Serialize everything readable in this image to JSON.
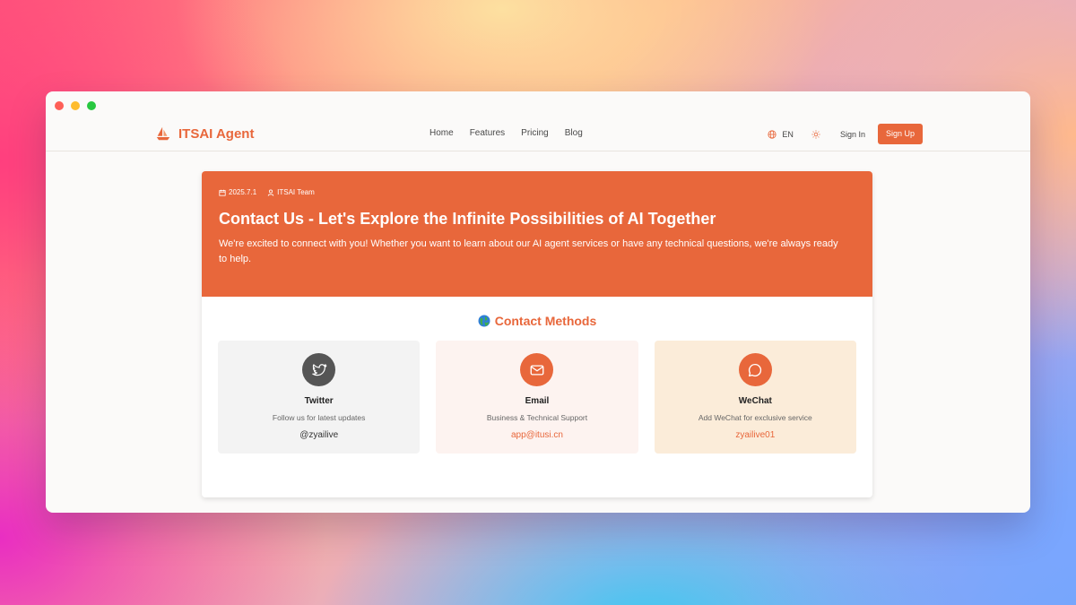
{
  "colors": {
    "accent": "#e8673b",
    "twitter_icon_bg": "#555555"
  },
  "brand": {
    "name": "ITSAI Agent",
    "logo_icon": "sailboat-icon"
  },
  "nav": {
    "links": [
      "Home",
      "Features",
      "Pricing",
      "Blog"
    ],
    "language": "EN",
    "sign_in": "Sign In",
    "sign_up": "Sign Up"
  },
  "hero": {
    "date": "2025.7.1",
    "author": "ITSAI Team",
    "title": "Contact Us - Let's Explore the Infinite Possibilities of AI Together",
    "description": "We're excited to connect with you! Whether you want to learn about our AI agent services or have any technical questions, we're always ready to help."
  },
  "contact": {
    "title": "Contact Methods",
    "methods": [
      {
        "name": "Twitter",
        "description": "Follow us for latest updates",
        "value": "@zyailive",
        "icon": "twitter-bird-icon"
      },
      {
        "name": "Email",
        "description": "Business & Technical Support",
        "value": "app@itusi.cn",
        "icon": "mail-icon"
      },
      {
        "name": "WeChat",
        "description": "Add WeChat for exclusive service",
        "value": "zyailive01",
        "icon": "chat-bubble-icon"
      }
    ]
  }
}
